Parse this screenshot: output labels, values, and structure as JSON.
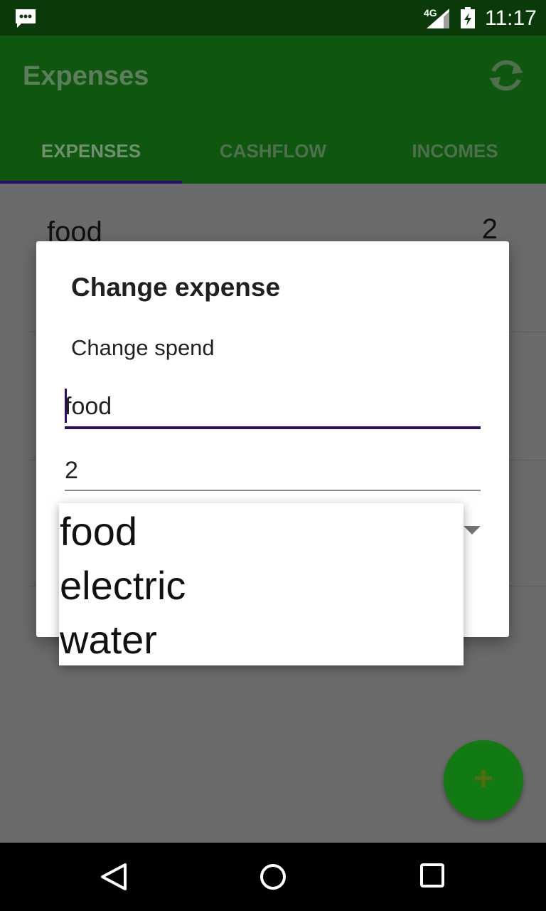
{
  "status_bar": {
    "network_label": "4G",
    "time": "11:17",
    "icons": [
      "message-icon",
      "signal-icon",
      "battery-icon"
    ]
  },
  "app_bar": {
    "title": "Expenses",
    "refresh_icon": "refresh-icon",
    "tabs": [
      {
        "label": "EXPENSES",
        "selected": true
      },
      {
        "label": "CASHFLOW",
        "selected": false
      },
      {
        "label": "INCOMES",
        "selected": false
      }
    ]
  },
  "list": {
    "rows": [
      {
        "name": "food",
        "value": "2"
      }
    ]
  },
  "dialog": {
    "title": "Change expense",
    "message": "Change spend",
    "name_field": {
      "value": "food"
    },
    "amount_field": {
      "value": "2"
    }
  },
  "dropdown": {
    "options": [
      "food",
      "electric",
      "water"
    ]
  },
  "fab": {
    "label": "+"
  },
  "nav_bar": {
    "buttons": [
      "back-icon",
      "home-icon",
      "recents-icon"
    ]
  },
  "colors": {
    "app_bar": "#0f560f",
    "status_bar": "#0a3a0a",
    "accent": "#2a0b6e",
    "fab": "#127a12",
    "scrim_background": "#6b6b6b"
  }
}
